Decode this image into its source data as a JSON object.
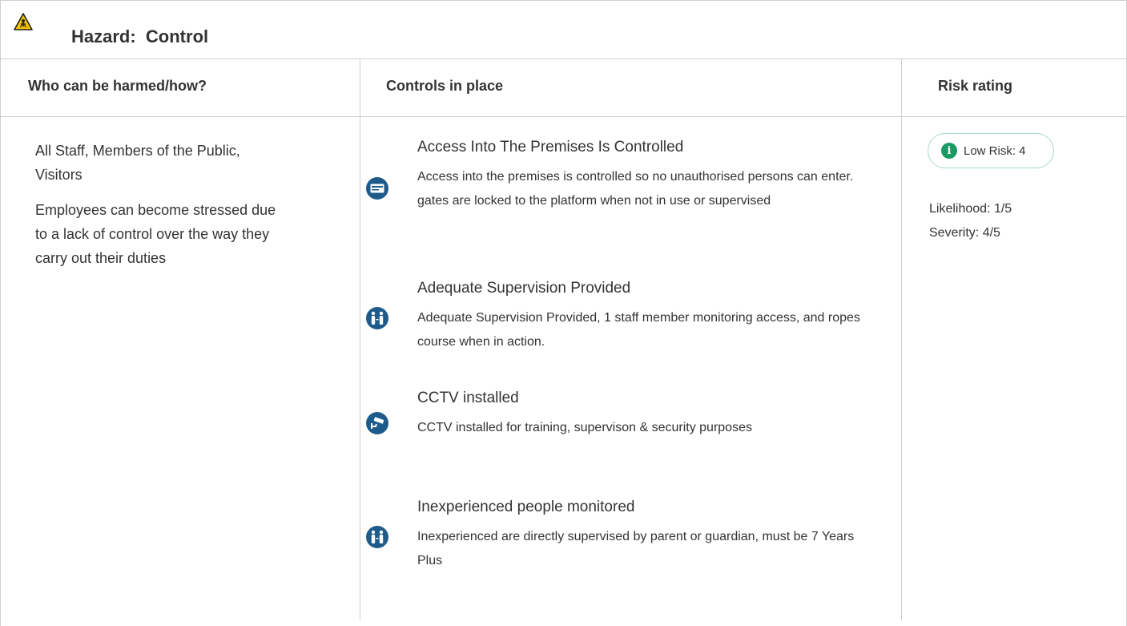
{
  "hazard": {
    "icon": "hazard-warning-icon",
    "label": "Hazard:",
    "name": "Control"
  },
  "columns": {
    "who": "Who can be harmed/how?",
    "controls": "Controls in place",
    "risk": "Risk rating"
  },
  "who": {
    "groups": "All Staff, Members of the Public, Visitors",
    "how": "Employees can become stressed due to a lack of control over the way they carry out their duties"
  },
  "controls": [
    {
      "icon": "pass-card-icon",
      "title": "Access Into The Premises Is Controlled",
      "description": "Access into the premises is controlled so no unauthorised persons can enter. gates are locked to the platform when not in use or supervised"
    },
    {
      "icon": "supervision-people-icon",
      "title": "Adequate Supervision Provided",
      "description": "Adequate Supervision Provided, 1 staff member monitoring access, and ropes course when in action."
    },
    {
      "icon": "cctv-camera-icon",
      "title": "CCTV installed",
      "description": "CCTV installed for training, supervison & security purposes"
    },
    {
      "icon": "supervision-people-icon",
      "title": "Inexperienced people monitored",
      "description": "Inexperienced are directly supervised by parent or guardian, must be 7 Years Plus"
    }
  ],
  "risk": {
    "badge_icon": "info-icon",
    "badge_text": "Low Risk: 4",
    "likelihood": "Likelihood: 1/5",
    "severity": "Severity: 4/5",
    "color": "#1c9a63"
  }
}
